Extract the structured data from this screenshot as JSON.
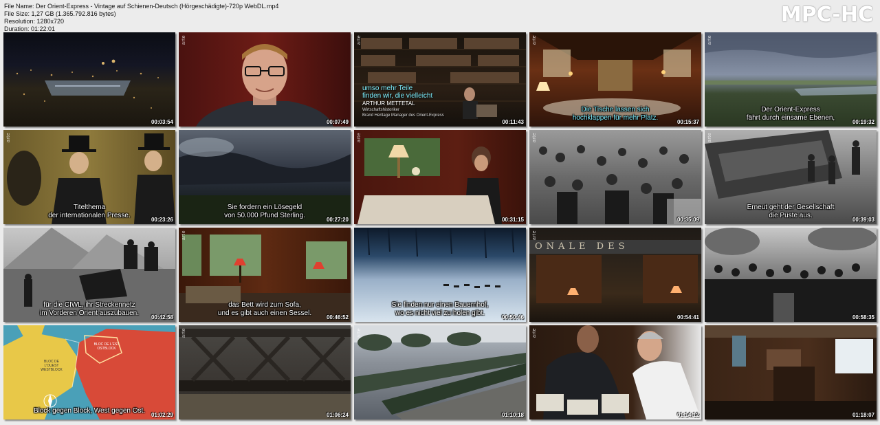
{
  "file_info": {
    "file_name": "File Name: Der Orient-Express - Vintage auf Schienen-Deutsch (Hörgeschädigte)-720p WebDL.mp4",
    "file_size": "File Size: 1,27 GB (1.365.792.816 bytes)",
    "resolution": "Resolution: 1280x720",
    "duration": "Duration: 01:22:01"
  },
  "brand": "MPC-HC",
  "channel_logo": "arte",
  "thumbnails": [
    {
      "time": "00:03:54",
      "sub1": "",
      "sub2": ""
    },
    {
      "time": "00:07:49",
      "sub1": "",
      "sub2": ""
    },
    {
      "time": "00:11:43",
      "sub1": "umso mehr Teile",
      "sub2": "finden wir, die vielleicht",
      "caption_name": "ARTHUR METTETAL",
      "caption_role1": "Wirtschaftshistoriker",
      "caption_role2": "Brand Heritage Manager des Orient-Express"
    },
    {
      "time": "00:15:37",
      "sub1": "Die Tische lassen sich",
      "sub2": "hochklappen für mehr Platz."
    },
    {
      "time": "00:19:32",
      "sub1": "Der Orient-Express",
      "sub2": "fährt durch einsame Ebenen,"
    },
    {
      "time": "00:23:26",
      "sub1": "Titelthema",
      "sub2": "der internationalen Presse."
    },
    {
      "time": "00:27:20",
      "sub1": "Sie fordern ein Lösegeld",
      "sub2": "von 50.000 Pfund Sterling."
    },
    {
      "time": "00:31:15",
      "sub1": "",
      "sub2": ""
    },
    {
      "time": "00:35:09",
      "sub1": "",
      "sub2": ""
    },
    {
      "time": "00:39:03",
      "sub1": "Erneut geht der Gesellschaft",
      "sub2": "die Puste aus."
    },
    {
      "time": "00:42:58",
      "sub1": "für die CIWL, ihr Streckennetz",
      "sub2": "im Vorderen Orient auszubauen."
    },
    {
      "time": "00:46:52",
      "sub1": "das Bett wird zum Sofa,",
      "sub2": "und es gibt auch einen Sessel."
    },
    {
      "time": "00:50:46",
      "sub1": "Sie finden nur einen Bauernhof,",
      "sub2": "wo es nicht viel zu holen gibt."
    },
    {
      "time": "00:54:41",
      "sub1": "",
      "sub2": "",
      "sign": "ONALE DES"
    },
    {
      "time": "00:58:35",
      "sub1": "",
      "sub2": ""
    },
    {
      "time": "01:02:29",
      "sub1": "",
      "sub2": "Block gegen Block, West gegen Ost.",
      "map_west": "BLOC DE L'OUEST WESTBLOCK",
      "map_east": "BLOC DE L'EST OSTBLOCK"
    },
    {
      "time": "01:06:24",
      "sub1": "",
      "sub2": ""
    },
    {
      "time": "01:10:18",
      "sub1": "",
      "sub2": ""
    },
    {
      "time": "01:14:12",
      "sub1": "",
      "sub2": ""
    },
    {
      "time": "01:18:07",
      "sub1": "",
      "sub2": ""
    }
  ]
}
